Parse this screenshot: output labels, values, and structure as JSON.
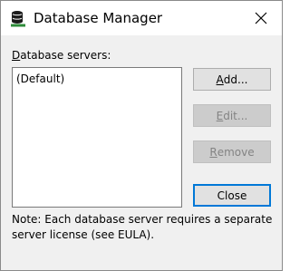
{
  "window": {
    "title": "Database Manager",
    "app_icon": "database-icon",
    "close_icon": "close-icon"
  },
  "servers": {
    "label_accel": "D",
    "label_rest": "atabase servers:",
    "items": [
      "(Default)"
    ]
  },
  "buttons": {
    "add": {
      "accel": "A",
      "rest": "dd...",
      "enabled": true
    },
    "edit": {
      "accel": "E",
      "rest": "dit...",
      "enabled": false
    },
    "remove": {
      "accel": "R",
      "rest": "emove",
      "enabled": false
    },
    "close": {
      "label": "Close",
      "enabled": true
    }
  },
  "note": "Note: Each database server requires a separate server license (see EULA).",
  "colors": {
    "titlebar": "#ffffff",
    "dialog_bg": "#f0f0f0",
    "default_button_border": "#0078d7",
    "icon_accent": "#2e8b3a"
  }
}
